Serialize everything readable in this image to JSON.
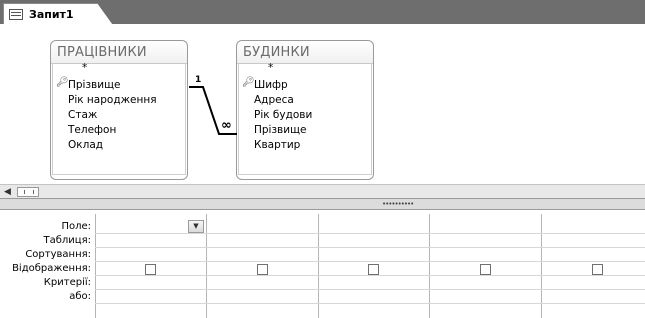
{
  "tab": {
    "title": "Запит1",
    "icon": "query-icon"
  },
  "tables": [
    {
      "name": "ПРАЦІВНИКИ",
      "fields": [
        "*",
        "Прізвище",
        "Рік народження",
        "Стаж",
        "Телефон",
        "Оклад"
      ],
      "key_field": "Прізвище"
    },
    {
      "name": "БУДИНКИ",
      "fields": [
        "*",
        "Шифр",
        "Адреса",
        "Рік будови",
        "Прізвище",
        "Квартир"
      ],
      "key_field": "Шифр"
    }
  ],
  "relationship": {
    "one_label": "1",
    "many_label": "∞"
  },
  "grid": {
    "row_labels": [
      "Поле:",
      "Таблиця:",
      "Сортування:",
      "Відображення:",
      "Критерії:",
      "або:"
    ],
    "columns": 5,
    "dropdown_icon": "chevron-down-icon"
  },
  "colors": {
    "tab_strip": "#6e6e6e",
    "border": "#9a9a9a"
  }
}
